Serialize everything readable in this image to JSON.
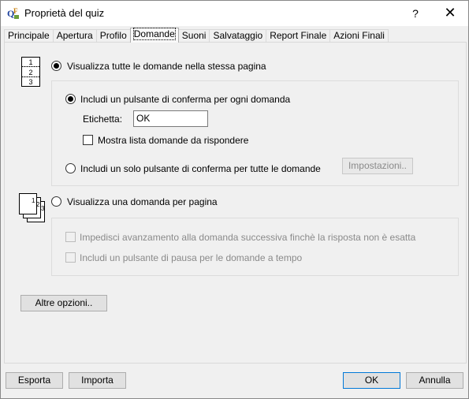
{
  "window": {
    "title": "Proprietà del quiz",
    "help_label": "?",
    "close_label": "✕"
  },
  "icons": {
    "app": "quiz-app-icon",
    "single_page": "single-page-questions-icon",
    "multi_page": "multiple-pages-icon"
  },
  "tabs": [
    {
      "label": "Principale"
    },
    {
      "label": "Apertura"
    },
    {
      "label": "Profilo"
    },
    {
      "label": "Domande"
    },
    {
      "label": "Suoni"
    },
    {
      "label": "Salvataggio"
    },
    {
      "label": "Report Finale"
    },
    {
      "label": "Azioni Finali"
    }
  ],
  "active_tab": "Domande",
  "page_single": {
    "icon_lines": [
      "1",
      "2",
      "3"
    ],
    "option_label": "Visualizza tutte le domande nella stessa pagina",
    "selected": true,
    "per_question": {
      "label": "Includi un pulsante di conferma per ogni domanda",
      "selected": true,
      "etichetta_label": "Etichetta:",
      "etichetta_value": "OK",
      "show_list_label": "Mostra lista domande da rispondere",
      "show_list_checked": false
    },
    "single_button": {
      "label": "Includi un solo pulsante di conferma per tutte le domande",
      "selected": false,
      "settings_label": "Impostazioni.."
    }
  },
  "page_multi": {
    "icon_lines": [
      "1",
      "2",
      "3"
    ],
    "option_label": "Visualizza una domanda per pagina",
    "selected": false,
    "prevent_label": "Impedisci avanzamento alla domanda successiva finchè la risposta non è esatta",
    "pause_label": "Includi un pulsante di pausa per le domande a tempo"
  },
  "more_options_label": "Altre opzioni..",
  "footer": {
    "export_label": "Esporta",
    "import_label": "Importa",
    "ok_label": "OK",
    "cancel_label": "Annulla"
  }
}
